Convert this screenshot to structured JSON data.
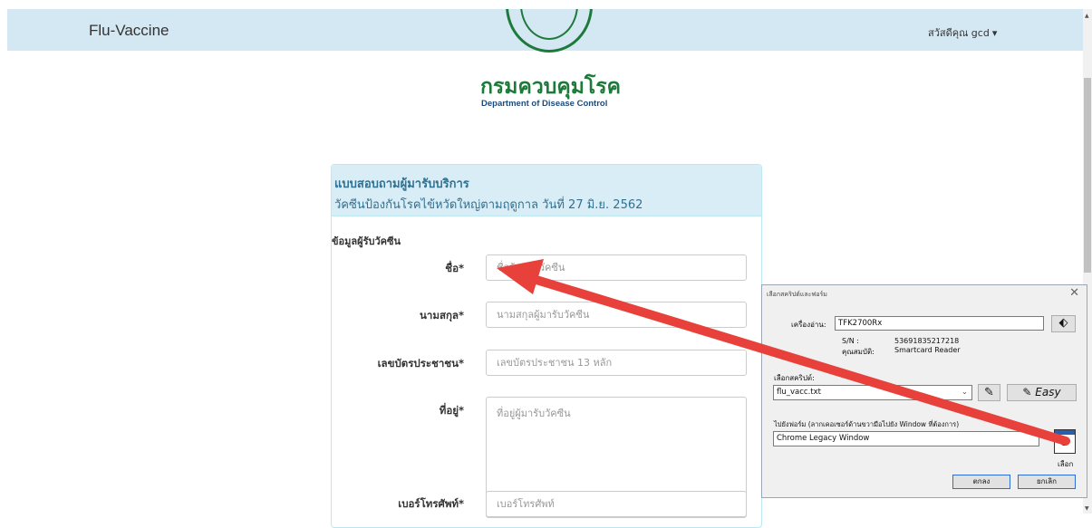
{
  "navbar": {
    "brand": "Flu-Vaccine",
    "user_greeting": "สวัสดีคุณ gcd",
    "caret": "▾"
  },
  "logo": {
    "title_th": "กรมควบคุมโรค",
    "title_en": "Department of Disease Control"
  },
  "panel": {
    "title": "แบบสอบถามผู้มารับบริการ",
    "subtitle": "วัคซีนป้องกันโรคไข้หวัดใหญ่ตามฤดูกาล วันที่ 27 มิ.ย. 2562"
  },
  "form": {
    "section_title": "ข้อมูลผู้รับวัคซีน",
    "first_name": {
      "label": "ชื่อ*",
      "placeholder": "ชื่อผู้มารับวัคซีน"
    },
    "last_name": {
      "label": "นามสกุล*",
      "placeholder": "นามสกุลผู้มารับวัคซีน"
    },
    "id_card": {
      "label": "เลขบัตรประชาชน*",
      "placeholder": "เลขบัตรประชาชน 13 หลัก"
    },
    "address": {
      "label": "ที่อยู่*",
      "placeholder": "ที่อยู่ผู้มารับวัคซีน"
    },
    "phone": {
      "label": "เบอร์โทรศัพท์*",
      "placeholder": "เบอร์โทรศัพท์"
    }
  },
  "dialog": {
    "title": "เลือกสคริปต์และฟอร์ม",
    "close": "✕",
    "reader_label": "เครื่องอ่าน:",
    "reader_value": "TFK2700Rx",
    "sn_label": "S/N :",
    "sn_value": "53691835217218",
    "attr_label": "คุณสมบัติ:",
    "attr_value": "Smartcard Reader",
    "script_label": "เลือกสคริปต์:",
    "script_value": "flu_vacc.txt",
    "easy_label": "Easy",
    "form_label": "ไปยังฟอร์ม (ลากเคอเซอร์ด้านขวามือไปยัง Window ที่ต้องการ)",
    "window_value": "Chrome Legacy Window",
    "pick_label": "เลือก",
    "ok_label": "ตกลง",
    "cancel_label": "ยกเลิก"
  },
  "colors": {
    "navbar_bg": "#d3e8f3",
    "panel_head_bg": "#d9edf7",
    "arrow": "#e8403a",
    "logo_green": "#1e7a3a"
  }
}
